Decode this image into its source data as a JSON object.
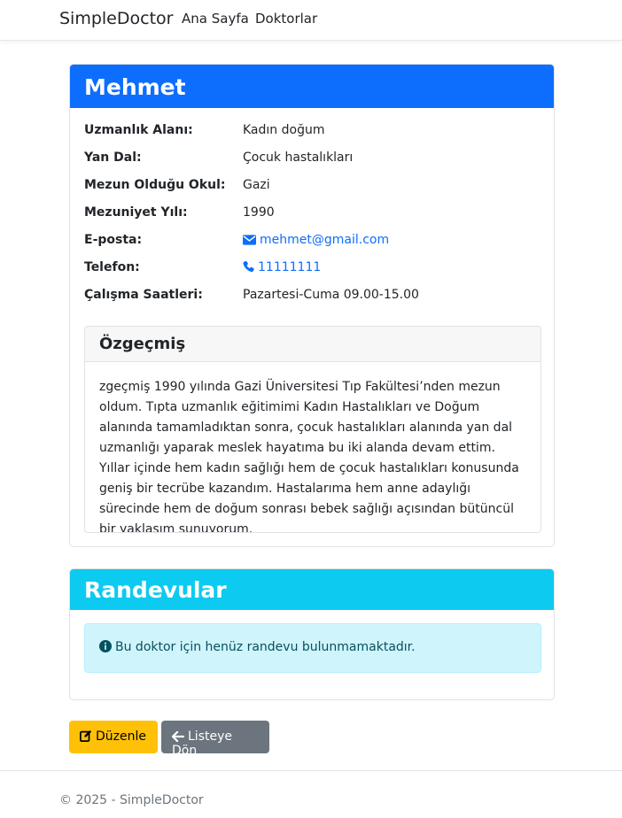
{
  "nav": {
    "brand": "SimpleDoctor",
    "links": [
      "Ana Sayfa",
      "Doktorlar"
    ]
  },
  "doctor": {
    "name": "Mehmet",
    "fields": [
      {
        "label": "Uzmanlık Alanı:",
        "value": "Kadın doğum"
      },
      {
        "label": "Yan Dal:",
        "value": "Çocuk hastalıkları"
      },
      {
        "label": "Mezun Olduğu Okul:",
        "value": "Gazi"
      },
      {
        "label": "Mezuniyet Yılı:",
        "value": "1990"
      },
      {
        "label": "E-posta:",
        "value": "mehmet@gmail.com",
        "icon": "envelope-icon"
      },
      {
        "label": "Telefon:",
        "value": "11111111",
        "icon": "phone-icon"
      },
      {
        "label": "Çalışma Saatleri:",
        "value": "Pazartesi-Cuma 09.00-15.00"
      }
    ],
    "bio_title": "Özgeçmiş",
    "bio": "zgeçmiş 1990 yılında Gazi Üniversitesi Tıp Fakültesi’nden mezun oldum. Tıpta uzmanlık eğitimimi Kadın Hastalıkları ve Doğum alanında tamamladıktan sonra, çocuk hastalıkları alanında yan dal uzmanlığı yaparak meslek hayatıma bu iki alanda devam ettim. Yıllar içinde hem kadın sağlığı hem de çocuk hastalıkları konusunda geniş bir tecrübe kazandım. Hastalarıma hem anne adaylığı sürecinde hem de doğum sonrası bebek sağlığı açısından bütüncül bir yaklaşım sunuyorum."
  },
  "appointments": {
    "title": "Randevular",
    "empty_message": "Bu doktor için henüz randevu bulunmamaktadır.",
    "icon": "info-circle-icon"
  },
  "actions": {
    "edit_label": "Düzenle",
    "edit_icon": "edit-icon",
    "back_label": "Listeye Dön",
    "back_icon": "arrow-left-icon"
  },
  "footer": {
    "text": "© 2025 - SimpleDoctor"
  },
  "colors": {
    "primary": "#0d6efd",
    "info": "#0dcaf0",
    "warning": "#ffc107",
    "secondary": "#6c757d",
    "alert_bg": "#cff4fc"
  }
}
